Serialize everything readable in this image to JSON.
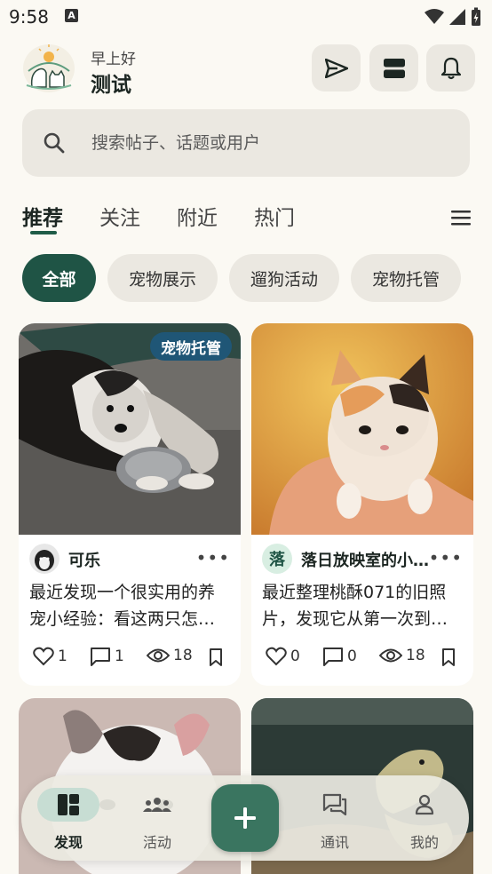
{
  "status_bar": {
    "time": "9:58",
    "notif_glyph": "A"
  },
  "header": {
    "greeting": "早上好",
    "username": "测试",
    "icons": [
      "send-icon",
      "layout-toggle-icon",
      "bell-icon"
    ]
  },
  "search": {
    "placeholder": "搜索帖子、话题或用户"
  },
  "tabs": [
    {
      "label": "推荐",
      "active": true
    },
    {
      "label": "关注"
    },
    {
      "label": "附近"
    },
    {
      "label": "热门"
    }
  ],
  "chips": [
    {
      "label": "全部",
      "active": true
    },
    {
      "label": "宠物展示"
    },
    {
      "label": "遛狗活动"
    },
    {
      "label": "宠物托管"
    }
  ],
  "posts": [
    {
      "badge": "宠物托管",
      "author": "可乐",
      "avatar_letter": "",
      "text_line1": "最近发现一个很实用的养",
      "text_line2": "宠小经验：看这两只怎…",
      "likes": "1",
      "comments": "1",
      "views": "18"
    },
    {
      "badge": "",
      "author": "落日放映室的小…",
      "avatar_letter": "落",
      "text_line1": "最近整理桃酥071的旧照",
      "text_line2": "片，发现它从第一次到…",
      "likes": "0",
      "comments": "0",
      "views": "18"
    }
  ],
  "bottom_nav": {
    "items": [
      {
        "label": "发现",
        "icon": "discover-icon",
        "active": true
      },
      {
        "label": "活动",
        "icon": "group-icon"
      },
      {
        "label": "通讯",
        "icon": "chat-icon"
      },
      {
        "label": "我的",
        "icon": "profile-icon"
      }
    ],
    "fab_icon": "plus-icon"
  },
  "more_glyph": "•••",
  "colors": {
    "accent": "#1f5445",
    "badge": "#1f5676",
    "background": "#fbf9f3"
  }
}
